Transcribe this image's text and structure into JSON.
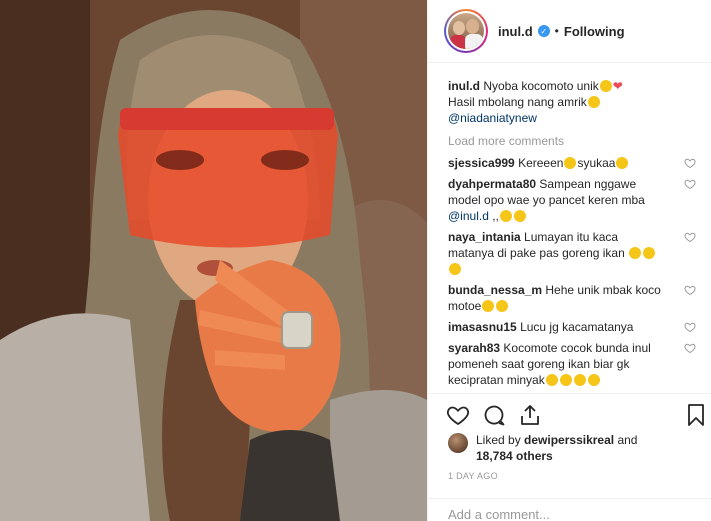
{
  "post": {
    "photo_alt": "",
    "username": "inul.d",
    "follow_status": "Following",
    "dot": "•",
    "caption": {
      "username": "inul.d",
      "line1": "Nyoba kocomoto unik",
      "line2": "Hasil mbolang nang amrik",
      "mention": "@niadaniatynew"
    },
    "load_more": "Load more comments",
    "comments": [
      {
        "username": "sjessica999",
        "text": "Kereeen",
        "text2": "syukaa"
      },
      {
        "username": "dyahpermata80",
        "text": "Sampean nggawe model opo wae yo pancet keren mba",
        "mention": "@inul.d",
        "text2": ",,"
      },
      {
        "username": "naya_intania",
        "text": "Lumayan itu kaca matanya di pake pas goreng ikan"
      },
      {
        "username": "bunda_nessa_m",
        "text": "Hehe unik mbak koco motoe"
      },
      {
        "username": "imasasnu15",
        "text": "Lucu jg kacamatanya"
      },
      {
        "username": "syarah83",
        "text": "Kocomote cocok bunda inul pomeneh saat goreng ikan biar gk kecipratan minyak"
      }
    ],
    "likes": {
      "prefix": "Liked by",
      "user": "dewiperssikreal",
      "and": "and",
      "others": "18,784 others"
    },
    "timestamp": "1 DAY AGO",
    "add_comment_placeholder": "Add a comment..."
  },
  "colors": {
    "accent_blue": "#3897f0",
    "link_blue": "#003569",
    "heart_red": "#ed4956"
  },
  "icons": [
    "verified-badge-icon",
    "heart-icon",
    "comment-icon",
    "share-icon",
    "bookmark-icon",
    "small-heart-icon"
  ]
}
